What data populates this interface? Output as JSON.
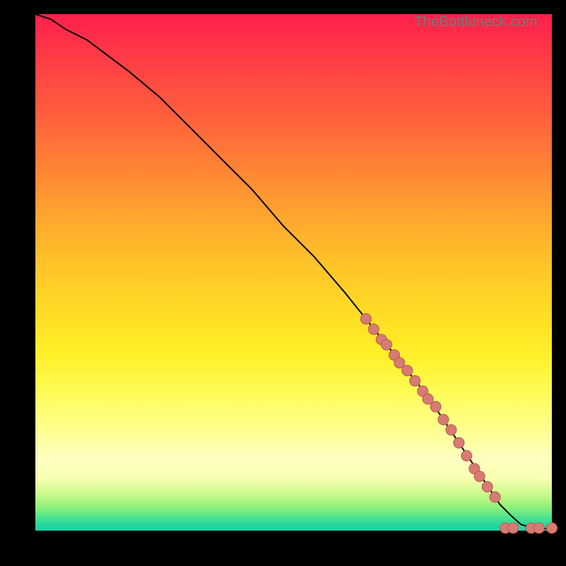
{
  "watermark": "TheBottleneck.com",
  "colors": {
    "dot_fill": "#d77b73",
    "dot_stroke": "#b45a52",
    "line": "#000000",
    "gradient_top": "#ff1f4b",
    "gradient_bottom": "#1fd2a5"
  },
  "chart_data": {
    "type": "line",
    "title": "",
    "xlabel": "",
    "ylabel": "",
    "xlim": [
      0,
      100
    ],
    "ylim": [
      0,
      100
    ],
    "series": [
      {
        "name": "curve",
        "x": [
          0,
          3,
          6,
          10,
          14,
          18,
          24,
          30,
          36,
          42,
          48,
          54,
          60,
          64,
          68,
          72,
          76,
          80,
          84,
          88,
          90,
          92,
          94,
          96,
          98,
          100
        ],
        "y": [
          100,
          99,
          97,
          95,
          92,
          89,
          84,
          78,
          72,
          66,
          59,
          53,
          46,
          41,
          36,
          31,
          26,
          20,
          14,
          8,
          5,
          3,
          1.2,
          0.6,
          0.4,
          0.4
        ]
      }
    ],
    "markers": [
      {
        "x": 64.0,
        "y": 41.0
      },
      {
        "x": 65.5,
        "y": 39.0
      },
      {
        "x": 67.0,
        "y": 37.0
      },
      {
        "x": 68.0,
        "y": 36.0
      },
      {
        "x": 69.5,
        "y": 34.0
      },
      {
        "x": 70.5,
        "y": 32.5
      },
      {
        "x": 72.0,
        "y": 31.0
      },
      {
        "x": 73.5,
        "y": 29.0
      },
      {
        "x": 75.0,
        "y": 27.0
      },
      {
        "x": 76.0,
        "y": 25.5
      },
      {
        "x": 77.5,
        "y": 24.0
      },
      {
        "x": 79.0,
        "y": 21.5
      },
      {
        "x": 80.5,
        "y": 19.5
      },
      {
        "x": 82.0,
        "y": 17.0
      },
      {
        "x": 83.5,
        "y": 14.5
      },
      {
        "x": 85.0,
        "y": 12.0
      },
      {
        "x": 86.0,
        "y": 10.5
      },
      {
        "x": 87.5,
        "y": 8.5
      },
      {
        "x": 89.0,
        "y": 6.5
      },
      {
        "x": 91.0,
        "y": 0.5
      },
      {
        "x": 92.5,
        "y": 0.5
      },
      {
        "x": 96.0,
        "y": 0.5
      },
      {
        "x": 97.5,
        "y": 0.5
      },
      {
        "x": 100.0,
        "y": 0.5
      }
    ]
  }
}
